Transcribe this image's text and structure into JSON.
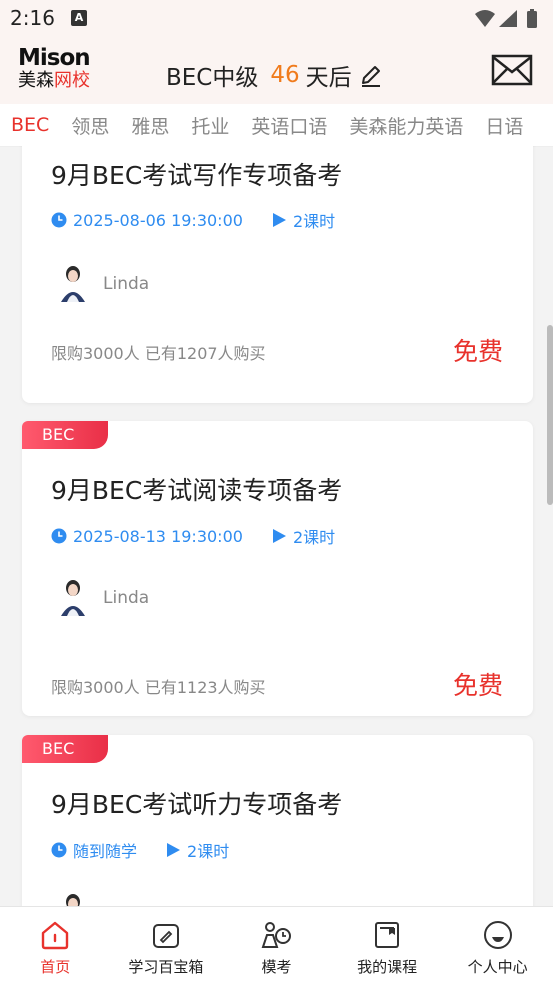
{
  "status_bar": {
    "time": "2:16",
    "notification_icon": "A"
  },
  "header": {
    "logo_top": "Mison",
    "logo_bottom_black": "美森",
    "logo_bottom_red": "网校",
    "exam_name": "BEC中级",
    "days_count": "46",
    "days_suffix": "天后"
  },
  "tabs": [
    {
      "label": "BEC"
    },
    {
      "label": "领思"
    },
    {
      "label": "雅思"
    },
    {
      "label": "托业"
    },
    {
      "label": "英语口语"
    },
    {
      "label": "美森能力英语"
    },
    {
      "label": "日语"
    }
  ],
  "courses": [
    {
      "title": "9月BEC考试写作专项备考",
      "time": "2025-08-06 19:30:00",
      "duration": "2课时",
      "teacher": "Linda",
      "limit": "限购3000人",
      "bought": "已有1207人购买",
      "price": "免费"
    },
    {
      "badge": "BEC",
      "title": "9月BEC考试阅读专项备考",
      "time": "2025-08-13 19:30:00",
      "duration": "2课时",
      "teacher": "Linda",
      "limit": "限购3000人",
      "bought": "已有1123人购买",
      "price": "免费"
    },
    {
      "badge": "BEC",
      "title": "9月BEC考试听力专项备考",
      "time": "随到随学",
      "duration": "2课时"
    }
  ],
  "bottom_nav": [
    {
      "label": "首页",
      "icon": "home-icon"
    },
    {
      "label": "学习百宝箱",
      "icon": "toolbox-icon"
    },
    {
      "label": "模考",
      "icon": "mock-exam-icon"
    },
    {
      "label": "我的课程",
      "icon": "my-courses-icon"
    },
    {
      "label": "个人中心",
      "icon": "profile-icon"
    }
  ],
  "colors": {
    "accent": "#e8322c",
    "link_blue": "#2f8cf0",
    "days_orange": "#f07b1c"
  }
}
